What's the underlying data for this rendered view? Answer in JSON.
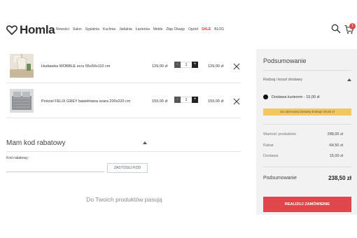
{
  "brand": {
    "logo_text": "Homla"
  },
  "nav": {
    "items": [
      "Nowości",
      "Salon",
      "Sypialnia",
      "Kuchnia",
      "Jadalnia",
      "Łazienka",
      "Meble",
      "Złap Okazję",
      "Ogród",
      "SALE",
      "BLOG"
    ]
  },
  "header_icons": {
    "search": "search-icon",
    "cart": "cart-icon",
    "cart_count": "1"
  },
  "cart": {
    "items": [
      {
        "name": "Huśtawka WOBBLE ecru 55x50x110 cm",
        "price": "129,00 zł",
        "qty": "1",
        "total": "129,00 zł"
      },
      {
        "name": "Pościel FELIX GREY bawełniana szara 200x220 cm",
        "price": "159,00 zł",
        "qty": "1",
        "total": "159,00 zł"
      }
    ]
  },
  "coupon": {
    "title": "Mam kod rabatowy",
    "label": "Kod rabatowy:",
    "value": "",
    "button": "ZASTOSUJ KOD"
  },
  "recommend": {
    "title": "Do Twoich produktów pasują"
  },
  "summary": {
    "title": "Podsumowanie",
    "shipping_header": "Rodzaj i koszt dostawy",
    "shipping_option": "Dostawa kurierem - 15,00 zł",
    "free_notice": "Do darmowej dostawy brakuje 25,50 zł",
    "rows": [
      {
        "label": "Wartość produktów",
        "value": "288,00 zł"
      },
      {
        "label": "Rabat",
        "value": "-64,50 zł"
      },
      {
        "label": "Dostawa",
        "value": "15,00 zł"
      }
    ],
    "total_label": "Podsumowanie",
    "total_value": "238,50 zł",
    "order_button": "REALIZUJ ZAMÓWIENIE"
  },
  "colors": {
    "accent": "#e0474c",
    "notice": "#f2c75e",
    "panel": "#f2f2f2"
  }
}
